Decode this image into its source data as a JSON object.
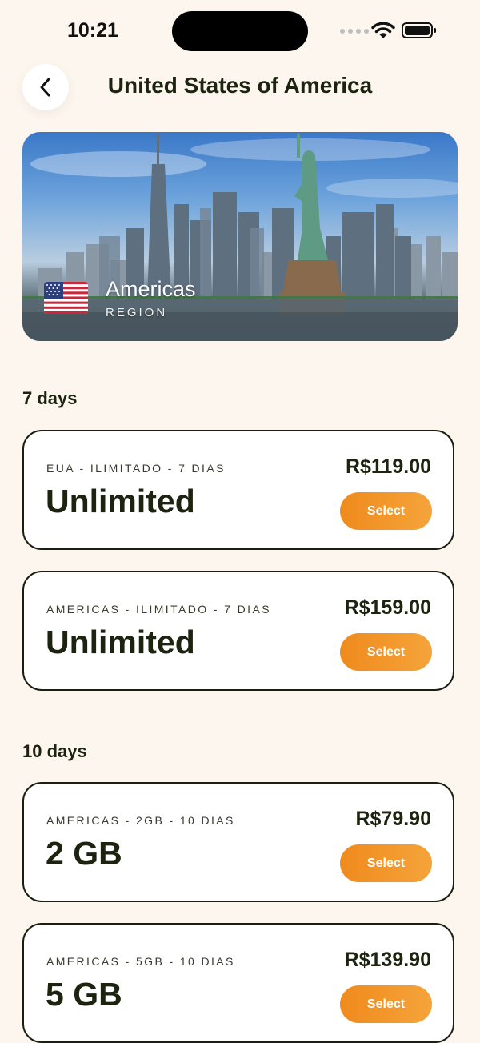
{
  "status_bar": {
    "time": "10:21"
  },
  "header": {
    "title": "United States of America",
    "back_icon": "chevron-left-icon"
  },
  "hero": {
    "name": "Americas",
    "subtitle": "REGION",
    "flag_icon": "us-flag-icon"
  },
  "sections": [
    {
      "title": "7 days",
      "plans": [
        {
          "code": "EUA - ILIMITADO - 7 DIAS",
          "data": "Unlimited",
          "price": "R$119.00",
          "button": "Select"
        },
        {
          "code": "AMERICAS - ILIMITADO - 7 DIAS",
          "data": "Unlimited",
          "price": "R$159.00",
          "button": "Select"
        }
      ]
    },
    {
      "title": "10 days",
      "plans": [
        {
          "code": "AMERICAS - 2GB - 10 DIAS",
          "data": "2 GB",
          "price": "R$79.90",
          "button": "Select"
        },
        {
          "code": "AMERICAS - 5GB - 10 DIAS",
          "data": "5 GB",
          "price": "R$139.90",
          "button": "Select"
        }
      ]
    }
  ],
  "colors": {
    "background": "#fdf6ee",
    "accent": "#f39a2a",
    "text": "#1c2410"
  }
}
